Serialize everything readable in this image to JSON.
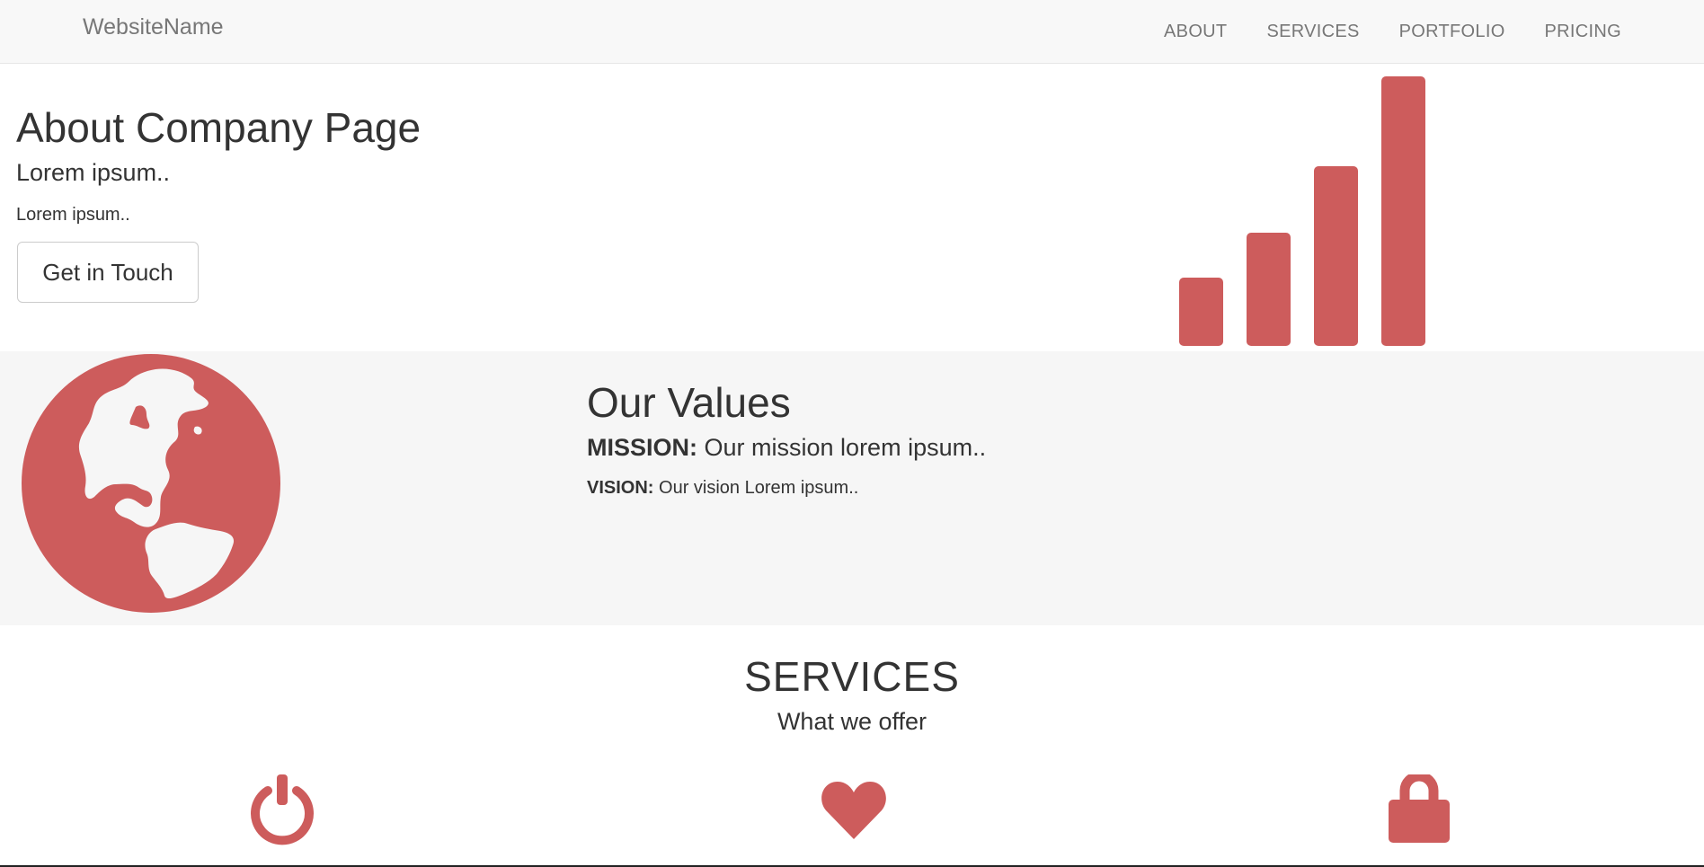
{
  "navbar": {
    "brand": "WebsiteName",
    "links": [
      "ABOUT",
      "SERVICES",
      "PORTFOLIO",
      "PRICING"
    ]
  },
  "hero": {
    "title": "About Company Page",
    "subtitle": "Lorem ipsum..",
    "text": "Lorem ipsum..",
    "button_label": "Get in Touch",
    "icon": "signal-icon"
  },
  "values": {
    "icon": "globe-icon",
    "title": "Our Values",
    "mission_label": "MISSION:",
    "mission_text": " Our mission lorem ipsum..",
    "vision_label": "VISION:",
    "vision_text": " Our vision Lorem ipsum.."
  },
  "services": {
    "title": "SERVICES",
    "subtitle": "What we offer",
    "icons": [
      "power-icon",
      "heart-icon",
      "lock-icon"
    ]
  },
  "colors": {
    "accent": "#cd5c5c",
    "navbar_bg": "#f8f8f8",
    "values_bg": "#f6f6f6",
    "text": "#333333",
    "nav_text": "#777777"
  }
}
